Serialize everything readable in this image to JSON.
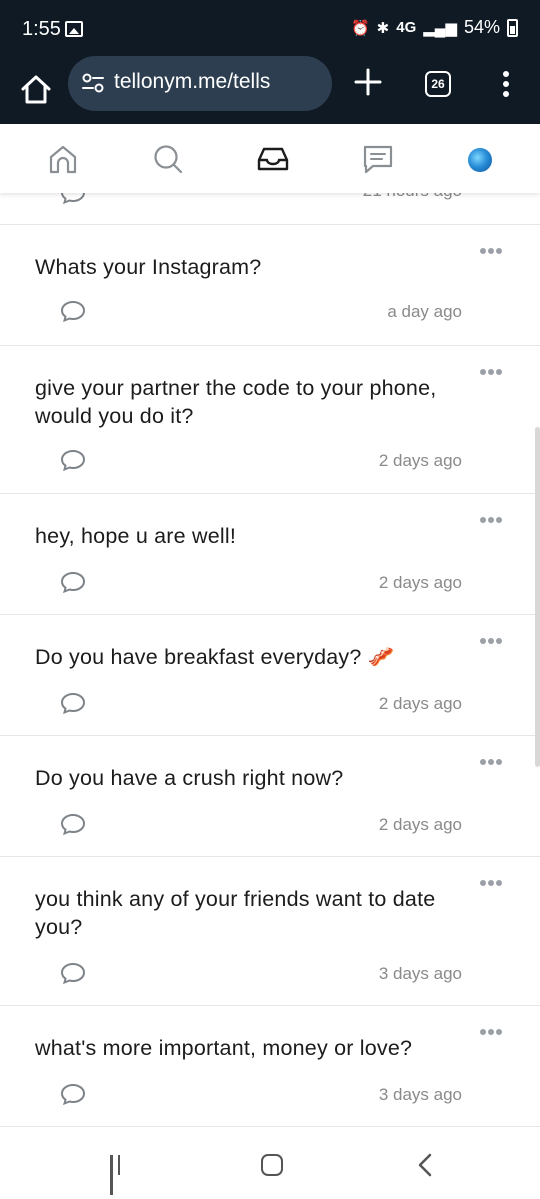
{
  "status_bar": {
    "time": "1:55",
    "network": "4G",
    "battery": "54%"
  },
  "browser": {
    "url": "tellonym.me/tells",
    "tab_count": "26"
  },
  "app_nav": {
    "items": [
      "home-icon",
      "search-icon",
      "inbox-icon",
      "chat-icon",
      "avatar"
    ]
  },
  "feed": {
    "partial_time": "21 hours ago",
    "tells": [
      {
        "text": "Whats your Instagram?",
        "time": "a day ago"
      },
      {
        "text": "give your partner the code to your phone, would you do it?",
        "time": "2 days ago"
      },
      {
        "text": "hey, hope u are well!",
        "time": "2 days ago"
      },
      {
        "text": "Do you have breakfast everyday? 🥓",
        "time": "2 days ago"
      },
      {
        "text": "Do you have a crush right now?",
        "time": "2 days ago"
      },
      {
        "text": "you think any of your friends want to date you?",
        "time": "3 days ago"
      },
      {
        "text": "what's more important, money or love?",
        "time": "3 days ago"
      }
    ]
  },
  "colors": {
    "toolbar_bg": "#0f1a24",
    "url_box_bg": "#2c3e4f",
    "text": "#1c1c1c",
    "muted": "#8a8a8a"
  }
}
